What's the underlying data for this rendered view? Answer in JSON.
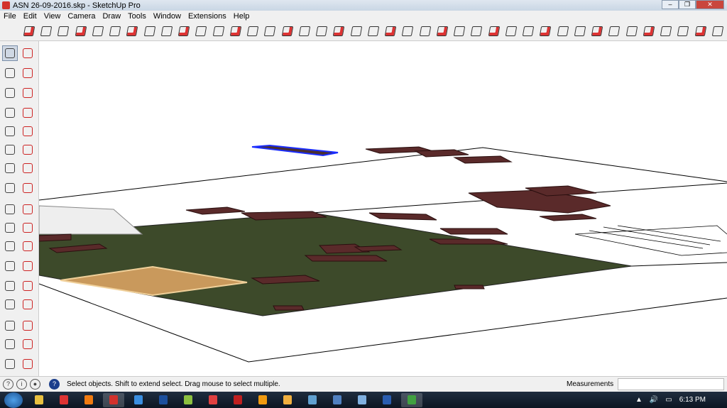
{
  "window": {
    "title": "ASN 26-09-2016.skp - SketchUp Pro",
    "buttons": [
      "minimize",
      "restore",
      "close"
    ]
  },
  "menu": [
    "File",
    "Edit",
    "View",
    "Camera",
    "Draw",
    "Tools",
    "Window",
    "Extensions",
    "Help"
  ],
  "status": {
    "message": "Select objects. Shift to extend select. Drag mouse to select multiple.",
    "measurements_label": "Measurements",
    "measurements_value": ""
  },
  "taskbar": {
    "time": "6:13 PM",
    "apps": [
      {
        "name": "explorer",
        "color": "#e8c040"
      },
      {
        "name": "acrobat",
        "color": "#d33"
      },
      {
        "name": "media-player",
        "color": "#f07a10"
      },
      {
        "name": "sketchup",
        "color": "#d2322d",
        "active": true
      },
      {
        "name": "internet-explorer",
        "color": "#3a8ee0"
      },
      {
        "name": "photoshop",
        "color": "#1c4f9c"
      },
      {
        "name": "files",
        "color": "#8cc040"
      },
      {
        "name": "calendar",
        "color": "#e04040"
      },
      {
        "name": "app-red",
        "color": "#c02020"
      },
      {
        "name": "illustrator",
        "color": "#f09a10"
      },
      {
        "name": "app-orange",
        "color": "#f0b040"
      },
      {
        "name": "app-image",
        "color": "#60a0d0"
      },
      {
        "name": "app-usb",
        "color": "#5080c0"
      },
      {
        "name": "app-doc",
        "color": "#80b0e0"
      },
      {
        "name": "word",
        "color": "#2a5db0"
      },
      {
        "name": "chrome",
        "color": "#40a040",
        "active": true
      }
    ]
  },
  "colors": {
    "accent": "#d2322d",
    "ground": "#3d4a2a",
    "object": "#5a2a2a",
    "deck": "#d9b07a",
    "selection": "#1a2cff"
  }
}
